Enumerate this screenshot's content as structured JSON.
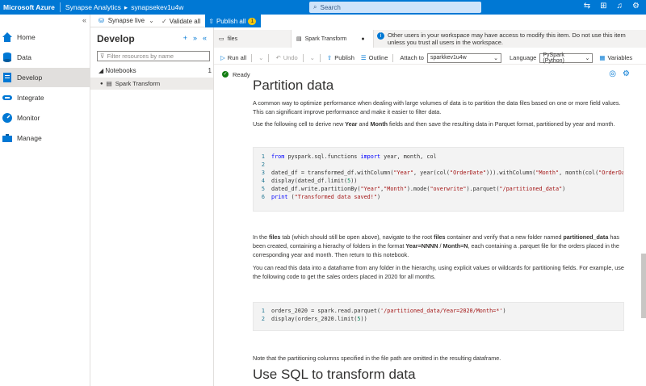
{
  "topbar": {
    "brand": "Microsoft Azure",
    "crumb1": "Synapse Analytics",
    "crumb_sep": "▸",
    "crumb2": "synapsekev1u4w",
    "search_placeholder": "Search"
  },
  "leftnav": {
    "collapse": "«",
    "items": [
      {
        "label": "Home",
        "icon": "home-icon"
      },
      {
        "label": "Data",
        "icon": "database-icon"
      },
      {
        "label": "Develop",
        "icon": "document-icon"
      },
      {
        "label": "Integrate",
        "icon": "pipeline-icon"
      },
      {
        "label": "Monitor",
        "icon": "gauge-icon"
      },
      {
        "label": "Manage",
        "icon": "toolbox-icon"
      }
    ]
  },
  "develop": {
    "title": "Develop",
    "filter_placeholder": "Filter resources by name",
    "group_label": "Notebooks",
    "group_count": "1",
    "item": "Spark Transform"
  },
  "toolbar1": {
    "live": "Synapse live",
    "validate": "Validate all",
    "publish": "Publish all",
    "publish_count": "1"
  },
  "tabs": {
    "files": "files",
    "spark": "Spark Transform",
    "info": "Other users in your workspace may have access to modify this item. Do not use this item unless you trust all users in the workspace."
  },
  "toolbar2": {
    "run_all": "Run all",
    "undo": "Undo",
    "publish": "Publish",
    "outline": "Outline",
    "attach_label": "Attach to",
    "attach_value": "sparkkev1u4w",
    "language_label": "Language",
    "language_value": "PySpark (Python)",
    "variables": "Variables"
  },
  "status": {
    "text": "Ready"
  },
  "notebook": {
    "heading1": "Partition data",
    "p1": "A common way to optimize performance when dealing with large volumes of data is to partition the data files based on one or more field values. This can significant improve performance and make it easier to filter data.",
    "p2_a": "Use the following cell to derive new ",
    "p2_b": "Year",
    "p2_c": " and ",
    "p2_d": "Month",
    "p2_e": " fields and then save the resulting data in Parquet format, partitioned by year and month.",
    "p3_a": "In the ",
    "p3_b": "files",
    "p3_c": " tab (which should still be open above), navigate to the root ",
    "p3_d": "files",
    "p3_e": " container and verify that a new folder named ",
    "p3_f": "partitioned_data",
    "p3_g": " has been created, containing a hierachy of folders in the format ",
    "p3_h": "Year=NNNN",
    "p3_i": " / ",
    "p3_j": "Month=N",
    "p3_k": ", each containing a .parquet file for the orders placed in the corresponding year and month. Then return to this notebook.",
    "p4": "You can read this data into a dataframe from any folder in the hierarchy, using explicit values or wildcards for partitioning fields. For example, use the following code to get the sales orders placed in 2020 for all months.",
    "p5": "Note that the partitioning columns specified in the file path are omitted in the resulting dataframe.",
    "heading2": "Use SQL to transform data",
    "cell1_lines": [
      "1",
      "2",
      "3",
      "4",
      "5",
      "6"
    ],
    "cell2_lines": [
      "1",
      "2"
    ]
  }
}
